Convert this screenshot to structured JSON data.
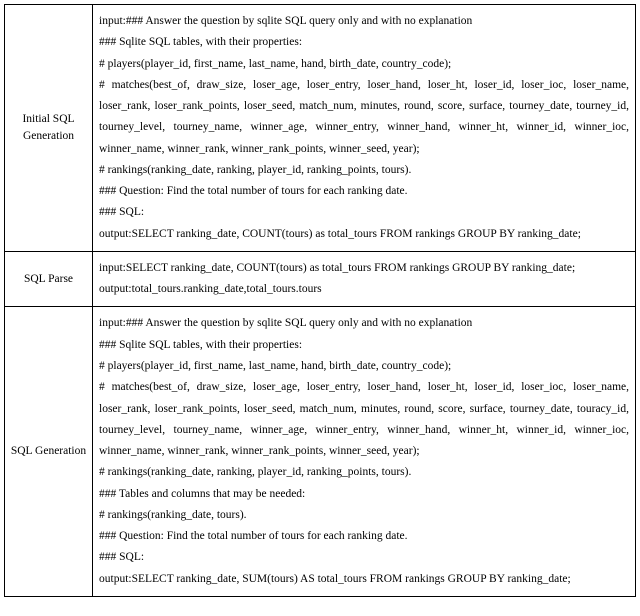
{
  "rows": [
    {
      "label": "Initial SQL Generation",
      "lines": [
        "input:### Answer the question by sqlite SQL query only and with no explanation",
        "### Sqlite SQL tables, with their properties:",
        "# players(player_id, first_name, last_name, hand, birth_date, country_code);",
        "# matches(best_of, draw_size, loser_age, loser_entry, loser_hand, loser_ht, loser_id, loser_ioc, loser_name, loser_rank, loser_rank_points, loser_seed, match_num, minutes, round, score, surface, tourney_date, tourney_id, tourney_level, tourney_name, winner_age, winner_entry, winner_hand, winner_ht, winner_id, winner_ioc, winner_name, winner_rank, winner_rank_points, winner_seed, year);",
        "# rankings(ranking_date, ranking, player_id, ranking_points, tours).",
        "### Question: Find the total number of tours for each ranking date.",
        "### SQL:",
        "output:SELECT ranking_date, COUNT(tours) as total_tours   FROM rankings   GROUP BY ranking_date;"
      ]
    },
    {
      "label": "SQL Parse",
      "lines": [
        "input:SELECT ranking_date, COUNT(tours) as total_tours   FROM rankings   GROUP BY ranking_date;",
        "output:total_tours.ranking_date,total_tours.tours"
      ]
    },
    {
      "label": "SQL Generation",
      "lines": [
        "input:### Answer the question by sqlite SQL query only and with no explanation",
        "### Sqlite SQL tables, with their properties:",
        "# players(player_id, first_name, last_name, hand, birth_date, country_code);",
        "# matches(best_of, draw_size, loser_age, loser_entry, loser_hand, loser_ht, loser_id, loser_ioc, loser_name, loser_rank, loser_rank_points, loser_seed, match_num, minutes, round, score, surface, tourney_date, touracy_id, tourney_level, tourney_name, winner_age, winner_entry, winner_hand, winner_ht, winner_id, winner_ioc, winner_name, winner_rank, winner_rank_points, winner_seed, year);",
        "# rankings(ranking_date, ranking, player_id, ranking_points, tours).",
        "### Tables and columns that may be needed:",
        "# rankings(ranking_date, tours).",
        "### Question: Find the total number of tours for each ranking date.",
        "### SQL:",
        "output:SELECT ranking_date, SUM(tours) AS total_tours FROM rankings GROUP BY ranking_date;"
      ]
    }
  ]
}
